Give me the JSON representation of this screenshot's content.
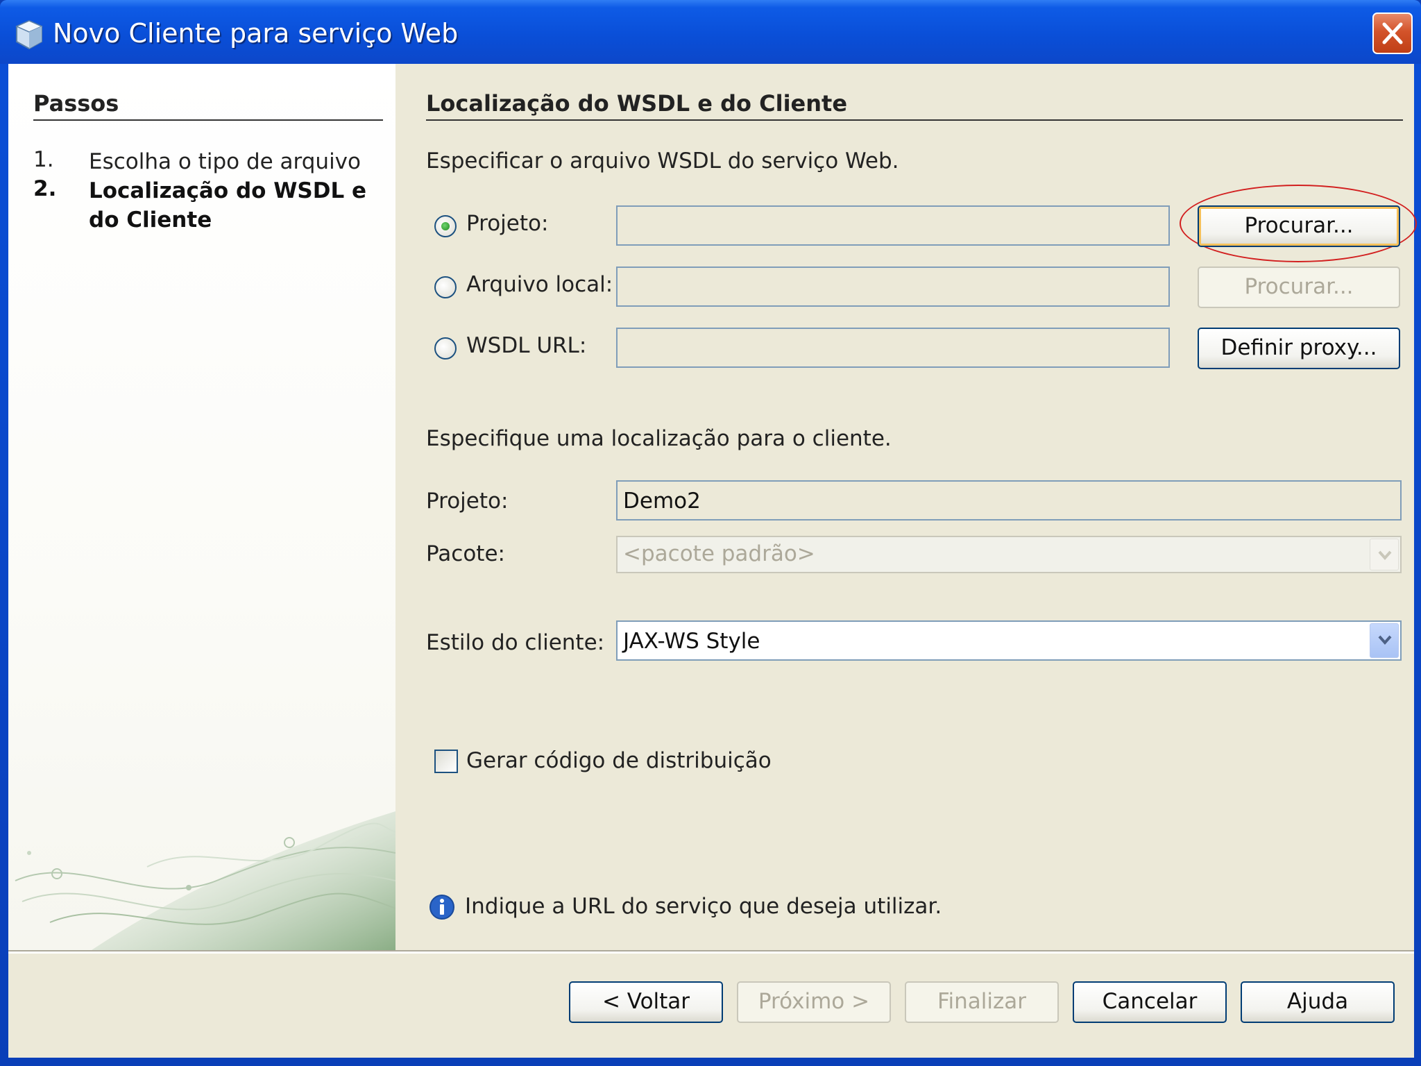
{
  "window": {
    "title": "Novo Cliente para serviço Web"
  },
  "steps": {
    "header": "Passos",
    "items": [
      {
        "num": "1.",
        "label": "Escolha o tipo de arquivo"
      },
      {
        "num": "2.",
        "label": "Localização do WSDL e do Cliente"
      }
    ]
  },
  "main": {
    "section_title": "Localização do WSDL e do Cliente",
    "wsdl_intro": "Especificar o arquivo WSDL do serviço Web.",
    "source_options": [
      {
        "label": "Projeto:",
        "selected": true,
        "value": "",
        "button": "Procurar...",
        "button_enabled": true
      },
      {
        "label": "Arquivo local:",
        "selected": false,
        "value": "",
        "button": "Procurar...",
        "button_enabled": false
      },
      {
        "label": "WSDL URL:",
        "selected": false,
        "value": "",
        "button": "Definir proxy...",
        "button_enabled": true
      }
    ],
    "client_intro": "Especifique uma localização para o cliente.",
    "project_label": "Projeto:",
    "project_value": "Demo2",
    "package_label": "Pacote:",
    "package_value": "<pacote padrão>",
    "style_label": "Estilo do cliente:",
    "style_value": "JAX-WS Style",
    "dispatch_label": "Gerar código de distribuição",
    "dispatch_checked": false,
    "info_message": "Indique a URL do serviço que deseja utilizar."
  },
  "footer": {
    "back": "< Voltar",
    "next": "Próximo >",
    "finish": "Finalizar",
    "cancel": "Cancelar",
    "help": "Ajuda"
  },
  "colors": {
    "titlebar": "#0a4fd8",
    "dialog_bg": "#ece9d8",
    "button_border": "#003c74",
    "highlight": "#d21f1f"
  }
}
